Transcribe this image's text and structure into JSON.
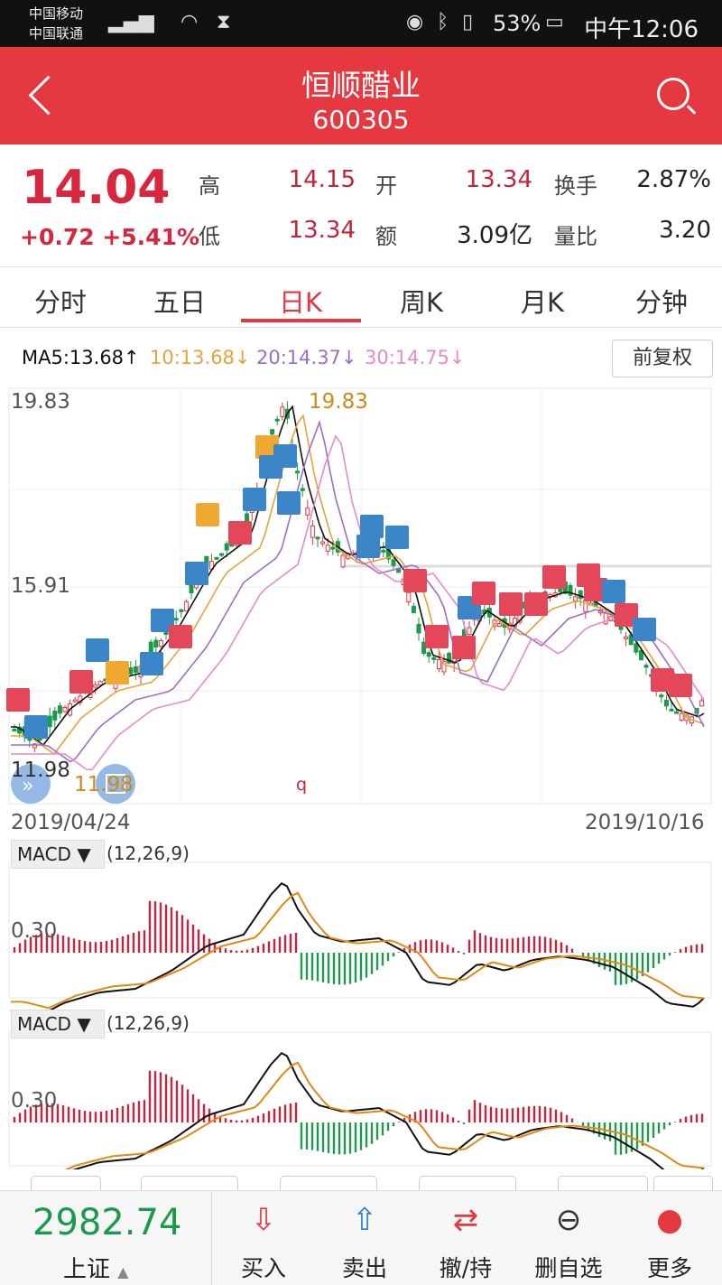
{
  "status_bar": {
    "carrier1": "中国移动",
    "carrier2": "中国联通",
    "battery": "53%",
    "time": "中午12:06"
  },
  "header": {
    "title": "恒顺醋业",
    "code": "600305"
  },
  "quote": {
    "price": "14.04",
    "change": "+0.72 +5.41%",
    "high_label": "高",
    "high": "14.15",
    "open_label": "开",
    "open": "13.34",
    "turnover_label": "换手",
    "turnover": "2.87%",
    "low_label": "低",
    "low": "13.34",
    "amount_label": "额",
    "amount": "3.09亿",
    "vol_ratio_label": "量比",
    "vol_ratio": "3.20"
  },
  "tabs": [
    "分时",
    "五日",
    "日K",
    "周K",
    "月K",
    "分钟"
  ],
  "active_tab": "日K",
  "ma_legend": {
    "ma5": "MA5:13.68↑",
    "ma10": "10:13.68↓",
    "ma20": "20:14.37↓",
    "ma30": "30:14.75↓",
    "colors": {
      "ma5": "#111111",
      "ma10": "#e9a23b",
      "ma20": "#9b6fc7",
      "ma30": "#e88ac9"
    }
  },
  "adjust_button": "前复权",
  "kline": {
    "y_top": "19.83",
    "y_mid": "15.91",
    "y_low": "11.98",
    "max_label": "19.83",
    "min_label": "11.98",
    "date_start": "2019/04/24",
    "date_end": "2019/10/16",
    "marker": "q"
  },
  "macd1": {
    "name": "MACD",
    "params": "(12,26,9)",
    "level": "0.30"
  },
  "macd2": {
    "name": "MACD",
    "params": "(12,26,9)",
    "level": "0.30"
  },
  "bottom_bar": {
    "index_value": "2982.74",
    "index_name": "上证",
    "buy": "买入",
    "sell": "卖出",
    "cancel": "撤/持",
    "remove": "删自选",
    "more": "更多",
    "colors": {
      "up": "#e53841",
      "down": "#1a9b4b"
    }
  }
}
